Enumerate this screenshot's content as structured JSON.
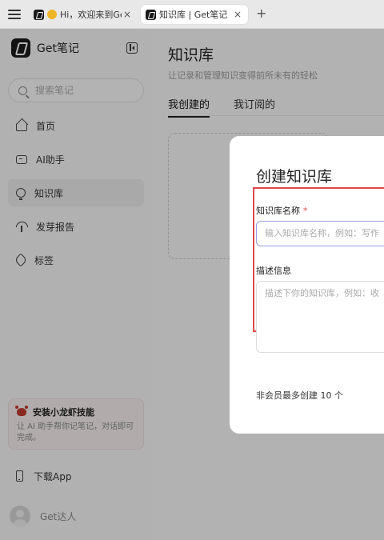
{
  "browser": {
    "tabs": [
      {
        "title": "Hi，欢迎来到Get",
        "active": false
      },
      {
        "title": "知识库 | Get笔记",
        "active": true
      }
    ],
    "close_glyph": "×",
    "new_tab_glyph": "+"
  },
  "sidebar": {
    "brand": "Get笔记",
    "search_placeholder": "搜索笔记",
    "items": [
      {
        "label": "首页",
        "icon": "home-icon"
      },
      {
        "label": "AI助手",
        "icon": "ai-chat-icon"
      },
      {
        "label": "知识库",
        "icon": "bulb-icon",
        "active": true
      },
      {
        "label": "发芽报告",
        "icon": "sprout-icon"
      },
      {
        "label": "标签",
        "icon": "tag-icon"
      }
    ],
    "promo": {
      "title": "安装小龙虾技能",
      "desc": "让 AI 助手帮你记笔记，对话即可完成。"
    },
    "download_label": "下载App",
    "user_name": "Get达人"
  },
  "main": {
    "title": "知识库",
    "subtitle": "让记录和管理知识变得前所未有的轻松",
    "tabs": [
      {
        "label": "我创建的",
        "active": true
      },
      {
        "label": "我订阅的",
        "active": false
      }
    ]
  },
  "modal": {
    "title": "创建知识库",
    "name_label": "知识库名称",
    "required_mark": "*",
    "name_placeholder": "输入知识库名称，例如：写作",
    "desc_label": "描述信息",
    "desc_placeholder": "描述下你的知识库，例如：收",
    "member_note": "非会员最多创建 10 个"
  },
  "colors": {
    "accent_highlight": "#e0484f",
    "input_focus": "#9a9ae0",
    "overlay": "rgba(0,0,0,0.28)"
  }
}
